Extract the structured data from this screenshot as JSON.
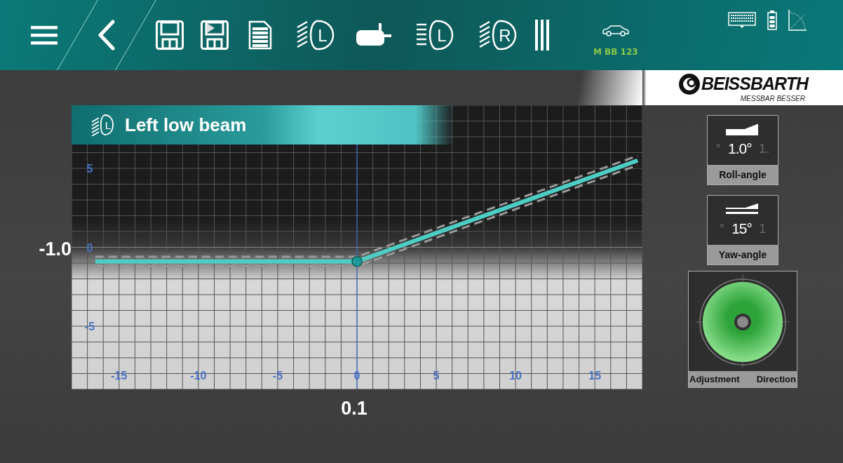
{
  "toolbar": [
    {
      "kind": "menu"
    },
    {
      "kind": "back"
    },
    {
      "kind": "save"
    },
    {
      "kind": "save-play"
    },
    {
      "kind": "document"
    },
    {
      "kind": "beam",
      "letter": "L",
      "angled": true
    },
    {
      "kind": "fog"
    },
    {
      "kind": "beam",
      "letter": "L",
      "angled": false
    },
    {
      "kind": "beam",
      "letter": "R",
      "angled": true
    },
    {
      "kind": "stripes"
    }
  ],
  "vehicle": {
    "plate": "M BB 123"
  },
  "status_icons": [
    {
      "kind": "keyboard"
    },
    {
      "kind": "battery"
    },
    {
      "kind": "curve"
    }
  ],
  "logo": {
    "name": "BEISSBARTH",
    "slogan": "MESSBAR BESSER"
  },
  "panel": {
    "title": "Left low beam",
    "letter": "L",
    "vertical_reading": "-1.0",
    "horizontal_reading": "0.1",
    "chart_data": {
      "type": "line",
      "grid": true,
      "x": [
        -16.5,
        0,
        17.7
      ],
      "series": [
        {
          "color": "#4ecdc4",
          "line_style": "solid",
          "values": [
            -0.9,
            -0.9,
            5.5
          ]
        },
        {
          "color": "#999999",
          "line_style": "dashed",
          "values": [
            -0.6,
            -0.6,
            5.8
          ]
        },
        {
          "color": "#999999",
          "line_style": "dashed",
          "values": [
            -1.2,
            -1.2,
            5.2
          ]
        }
      ],
      "ref_lines": [
        {
          "axis": "x",
          "value": 0,
          "color": "#3a6ee0"
        },
        {
          "axis": "y",
          "value": 0,
          "color": "#888888"
        }
      ],
      "xlim": [
        -18,
        18
      ],
      "ylim": [
        -9,
        9
      ],
      "xticks": [
        -15,
        -10,
        -5,
        0,
        5,
        10,
        15
      ],
      "yticks": [
        -5,
        0,
        5
      ]
    }
  },
  "gauges": [
    {
      "kind": "roll",
      "value": "1.0°",
      "prev": "°",
      "next": "1.",
      "label": "Roll-angle"
    },
    {
      "kind": "yaw",
      "value": "15°",
      "prev": "°",
      "next": "1",
      "label": "Yaw-angle"
    }
  ],
  "adjustment": {
    "label_1": "Adjustment",
    "label_2": "Direction",
    "color": "#2ea33a"
  }
}
